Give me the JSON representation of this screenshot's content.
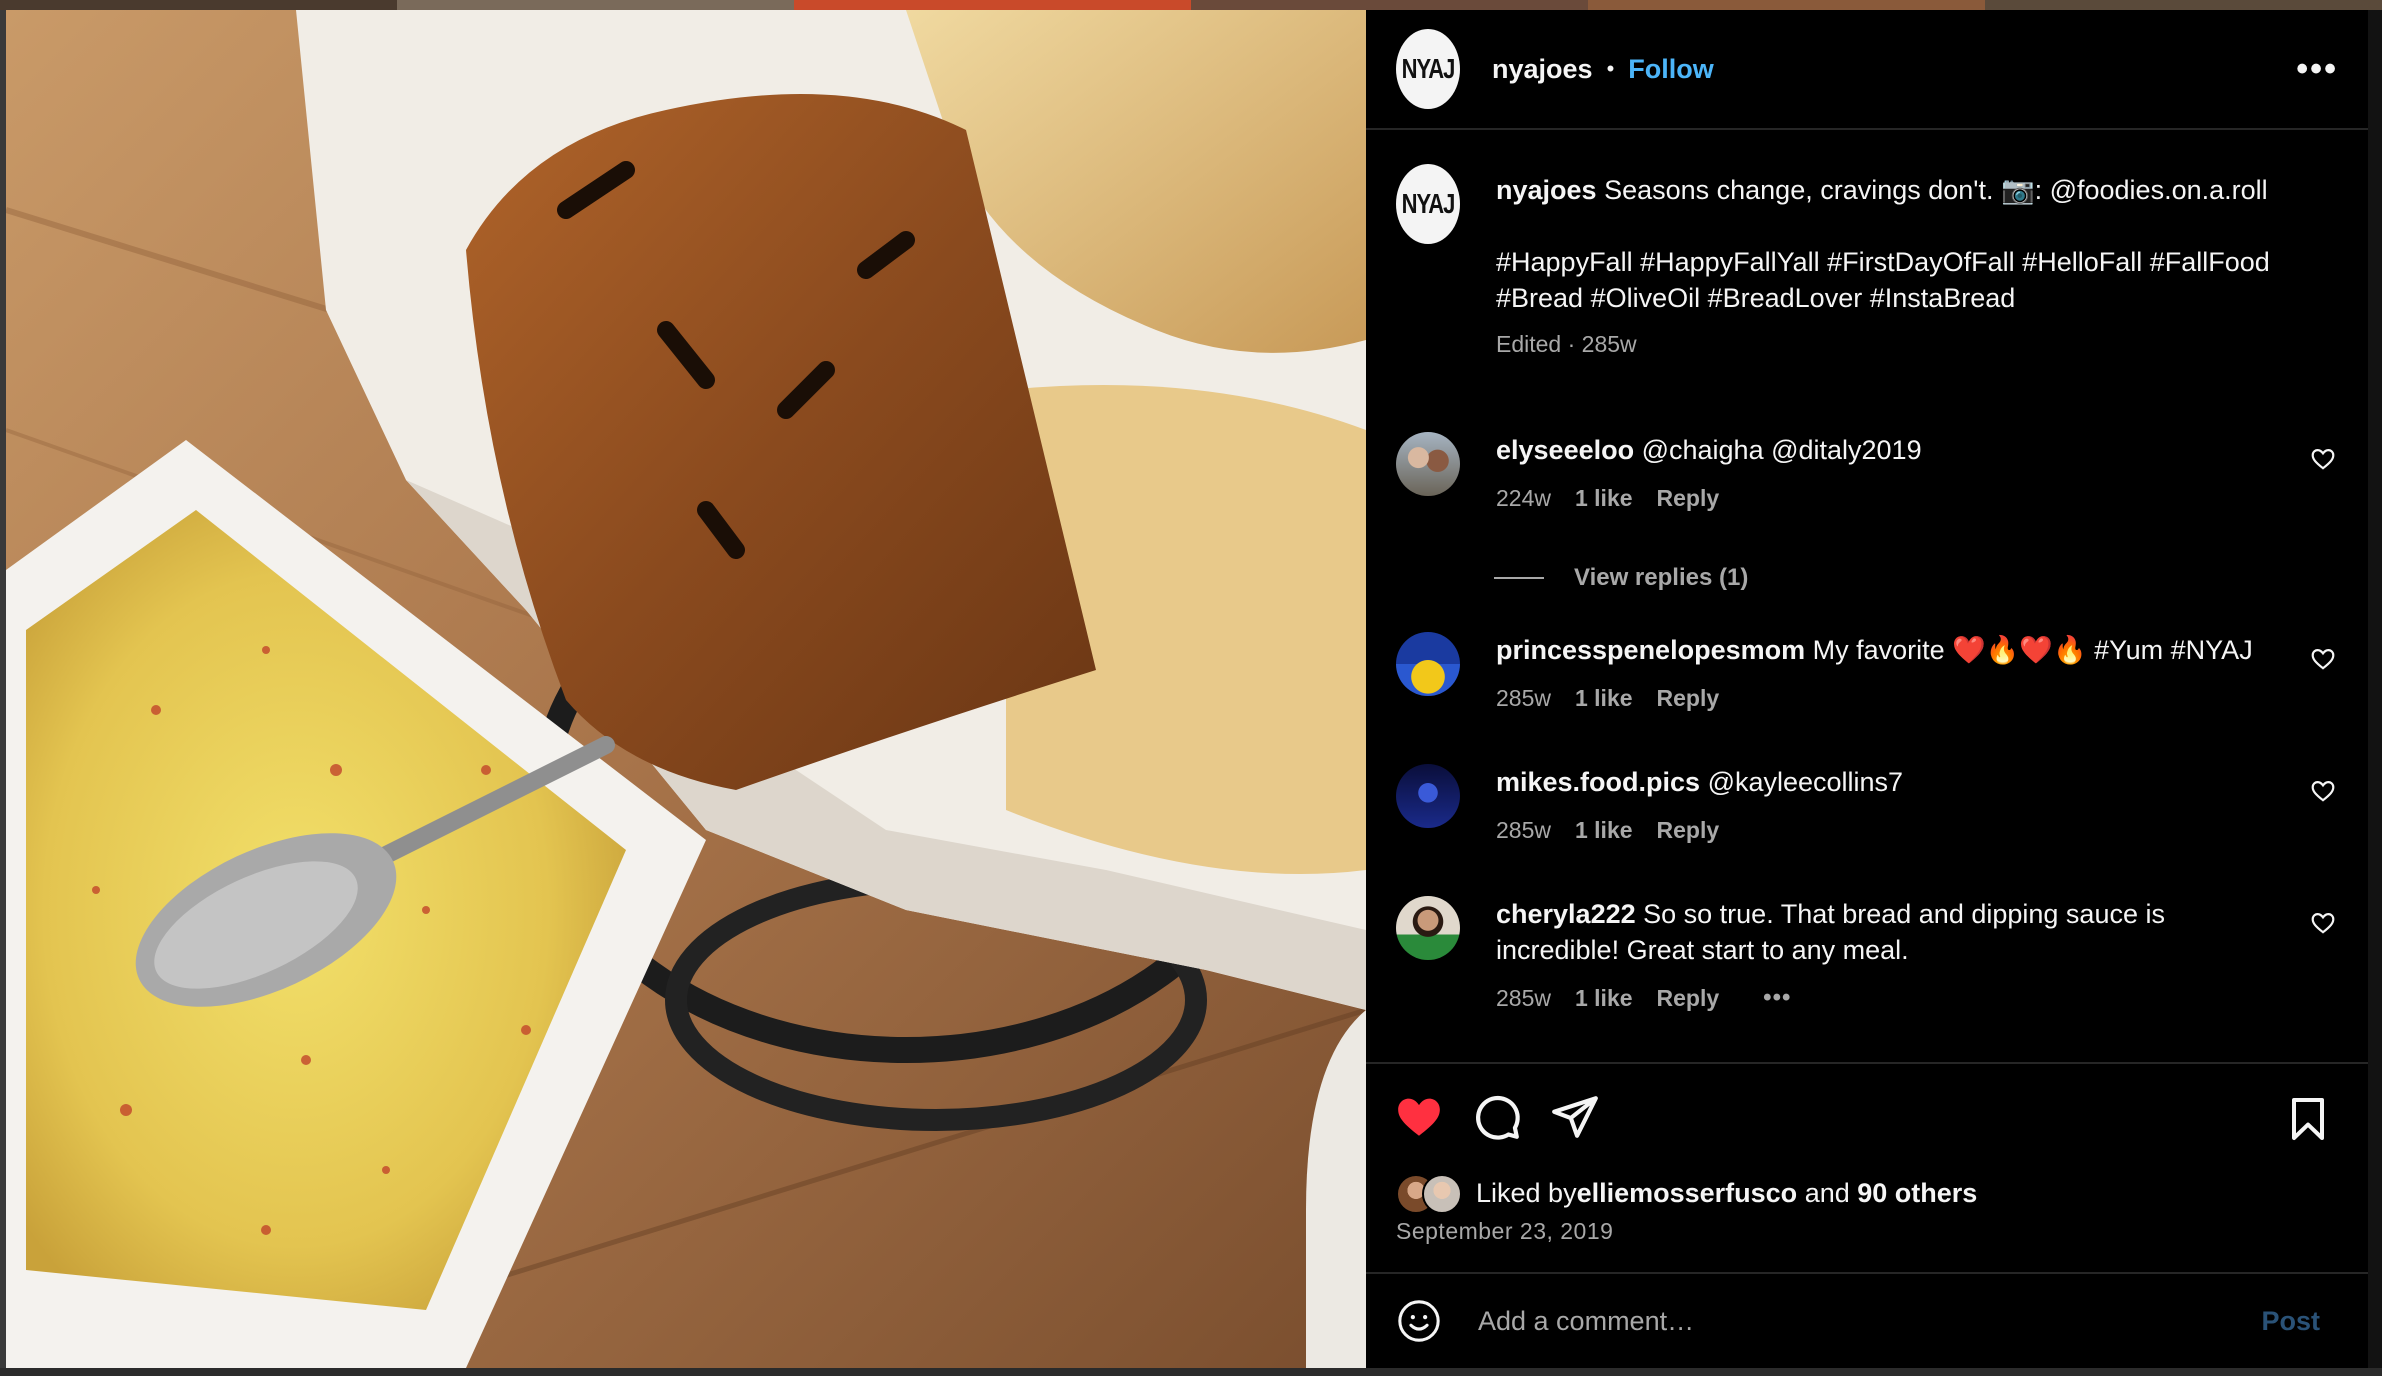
{
  "post": {
    "username": "nyajoes",
    "follow_label": "Follow",
    "separator": "•",
    "more_label": "•••",
    "avatar_text": "NYAJ",
    "image_description_icon": "food-photo"
  },
  "caption": {
    "username": "nyajoes",
    "text": " Seasons change, cravings don't. 📷: @foodies.on.a.roll",
    "hashtags": "#HappyFall #HappyFallYall #FirstDayOfFall #HelloFall #FallFood #Bread #OliveOil #BreadLover #InstaBread",
    "meta": "Edited · 285w"
  },
  "comments": [
    {
      "username": "elyseeeloo",
      "text": " @chaigha @ditaly2019",
      "age": "224w",
      "likes": "1 like",
      "reply": "Reply"
    },
    {
      "username": "princesspenelopesmom",
      "text": " My favorite ❤️🔥❤️🔥 #Yum #NYAJ",
      "age": "285w",
      "likes": "1 like",
      "reply": "Reply"
    },
    {
      "username": "mikes.food.pics",
      "text": " @kayleecollins7",
      "age": "285w",
      "likes": "1 like",
      "reply": "Reply"
    },
    {
      "username": "cheryla222",
      "text": " So so true. That bread and dipping sauce is incredible! Great start to any meal.",
      "age": "285w",
      "likes": "1 like",
      "reply": "Reply",
      "more": "•••"
    }
  ],
  "view_replies": "View replies (1)",
  "likes": {
    "prefix": "Liked by ",
    "user": "elliemosserfusco",
    "and": " and ",
    "others": "90 others"
  },
  "date": "September 23, 2019",
  "add_comment": {
    "placeholder": "Add a comment…",
    "post_label": "Post"
  },
  "colors": {
    "follow": "#4cb5f9",
    "liked_heart": "#ff3040",
    "post_disabled": "#2a5277"
  }
}
